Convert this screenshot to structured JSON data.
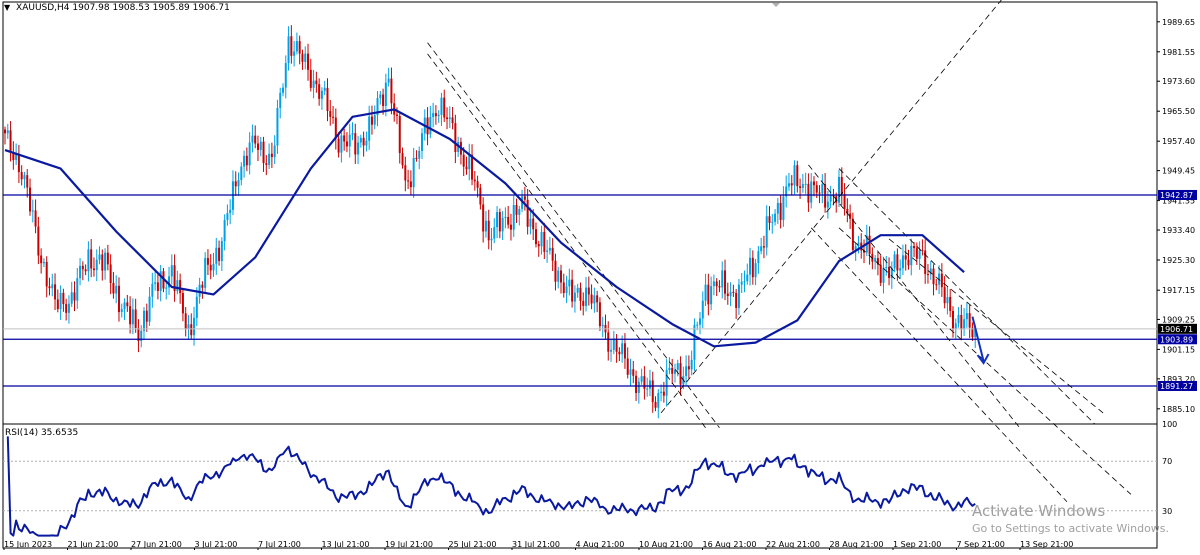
{
  "header": {
    "symbol_tf": "XAUUSD,H4",
    "ohlc": "1907.98 1908.53 1905.89 1906.71"
  },
  "rsi": {
    "label": "RSI(14) 35.6535",
    "levels": [
      "100",
      "70",
      "30",
      "0"
    ]
  },
  "watermark": {
    "line1": "Activate Windows",
    "line2": "Go to Settings to activate Windows."
  },
  "colors": {
    "bull": "#00a0e6",
    "bear": "#c80000",
    "ma": "#0a1aa0",
    "level_line": "#0000a0",
    "trend": "#000000",
    "arrow": "#1030c0"
  },
  "chart_data": {
    "type": "candlestick",
    "symbol": "XAUUSD",
    "timeframe": "H4",
    "ylim": [
      1881,
      1995
    ],
    "price_ticks": [
      "1989.65",
      "1981.55",
      "1973.60",
      "1965.50",
      "1957.40",
      "1949.45",
      "1941.35",
      "1933.40",
      "1925.30",
      "1917.15",
      "1909.25",
      "1901.15",
      "1893.20",
      "1885.10"
    ],
    "x_ticks": [
      "15 Jun 2023",
      "21 Jun 21:00",
      "27 Jun 21:00",
      "3 Jul 21:00",
      "7 Jul 21:00",
      "13 Jul 21:00",
      "19 Jul 21:00",
      "25 Jul 21:00",
      "31 Jul 21:00",
      "4 Aug 21:00",
      "10 Aug 21:00",
      "16 Aug 21:00",
      "22 Aug 21:00",
      "28 Aug 21:00",
      "1 Sep 21:00",
      "7 Sep 21:00",
      "13 Sep 21:00"
    ],
    "horizontal_levels": [
      {
        "value": 1942.87,
        "label": "1942.87"
      },
      {
        "value": 1903.89,
        "label": "1903.89"
      },
      {
        "value": 1891.27,
        "label": "1891.27"
      }
    ],
    "current_price": {
      "value": 1906.71,
      "label": "1906.71"
    },
    "close_anchors": [
      [
        0,
        1958
      ],
      [
        6,
        1950
      ],
      [
        12,
        1929
      ],
      [
        18,
        1913
      ],
      [
        24,
        1915
      ],
      [
        30,
        1926
      ],
      [
        36,
        1924
      ],
      [
        42,
        1913
      ],
      [
        48,
        1906
      ],
      [
        54,
        1918
      ],
      [
        60,
        1922
      ],
      [
        66,
        1906
      ],
      [
        72,
        1922
      ],
      [
        78,
        1930
      ],
      [
        84,
        1950
      ],
      [
        90,
        1957
      ],
      [
        96,
        1952
      ],
      [
        102,
        1985
      ],
      [
        108,
        1978
      ],
      [
        114,
        1970
      ],
      [
        120,
        1958
      ],
      [
        126,
        1956
      ],
      [
        132,
        1962
      ],
      [
        138,
        1975
      ],
      [
        144,
        1945
      ],
      [
        150,
        1958
      ],
      [
        156,
        1968
      ],
      [
        162,
        1958
      ],
      [
        168,
        1948
      ],
      [
        174,
        1932
      ],
      [
        180,
        1936
      ],
      [
        186,
        1940
      ],
      [
        192,
        1931
      ],
      [
        198,
        1923
      ],
      [
        204,
        1915
      ],
      [
        210,
        1917
      ],
      [
        216,
        1905
      ],
      [
        222,
        1899
      ],
      [
        228,
        1892
      ],
      [
        234,
        1888
      ],
      [
        240,
        1895
      ],
      [
        246,
        1896
      ],
      [
        252,
        1918
      ],
      [
        258,
        1918
      ],
      [
        264,
        1916
      ],
      [
        270,
        1926
      ],
      [
        276,
        1936
      ],
      [
        282,
        1946
      ],
      [
        288,
        1946
      ],
      [
        294,
        1942
      ],
      [
        300,
        1944
      ],
      [
        306,
        1930
      ],
      [
        312,
        1926
      ],
      [
        318,
        1921
      ],
      [
        324,
        1927
      ],
      [
        330,
        1926
      ],
      [
        336,
        1918
      ],
      [
        342,
        1909
      ],
      [
        348,
        1906.71
      ]
    ],
    "moving_average": {
      "type": "MA",
      "points": [
        [
          0,
          1955
        ],
        [
          20,
          1950
        ],
        [
          40,
          1933
        ],
        [
          60,
          1918
        ],
        [
          75,
          1916
        ],
        [
          90,
          1926
        ],
        [
          110,
          1950
        ],
        [
          125,
          1964
        ],
        [
          140,
          1966
        ],
        [
          160,
          1958
        ],
        [
          180,
          1946
        ],
        [
          200,
          1930
        ],
        [
          220,
          1918
        ],
        [
          240,
          1908
        ],
        [
          255,
          1902
        ],
        [
          270,
          1903
        ],
        [
          285,
          1909
        ],
        [
          300,
          1925
        ],
        [
          315,
          1932
        ],
        [
          330,
          1932
        ],
        [
          345,
          1922
        ]
      ]
    },
    "trendlines": [
      {
        "style": "dashed",
        "from": [
          152,
          1984
        ],
        "to": [
          257,
          1880
        ]
      },
      {
        "style": "dashed",
        "from": [
          152,
          1981
        ],
        "to": [
          252,
          1880
        ]
      },
      {
        "style": "dashed",
        "from": [
          236,
          1884
        ],
        "to": [
          360,
          1997
        ]
      },
      {
        "style": "dashed",
        "from": [
          289,
          1951
        ],
        "to": [
          365,
          1880
        ]
      },
      {
        "style": "dashed",
        "from": [
          290,
          1934
        ],
        "to": [
          382,
          1860
        ]
      },
      {
        "style": "dashed",
        "from": [
          300,
          1950
        ],
        "to": [
          392,
          1881
        ]
      },
      {
        "style": "dashed",
        "from": [
          300,
          1934
        ],
        "to": [
          405,
          1862
        ]
      },
      {
        "style": "dashed",
        "from": [
          318,
          1931
        ],
        "to": [
          395,
          1884
        ]
      }
    ],
    "arrow": {
      "from": [
        348,
        1910
      ],
      "to": [
        352,
        1898
      ]
    },
    "rsi": {
      "period": 14,
      "value": 35.6535,
      "levels": [
        70,
        30
      ],
      "range": [
        0,
        100
      ]
    }
  }
}
